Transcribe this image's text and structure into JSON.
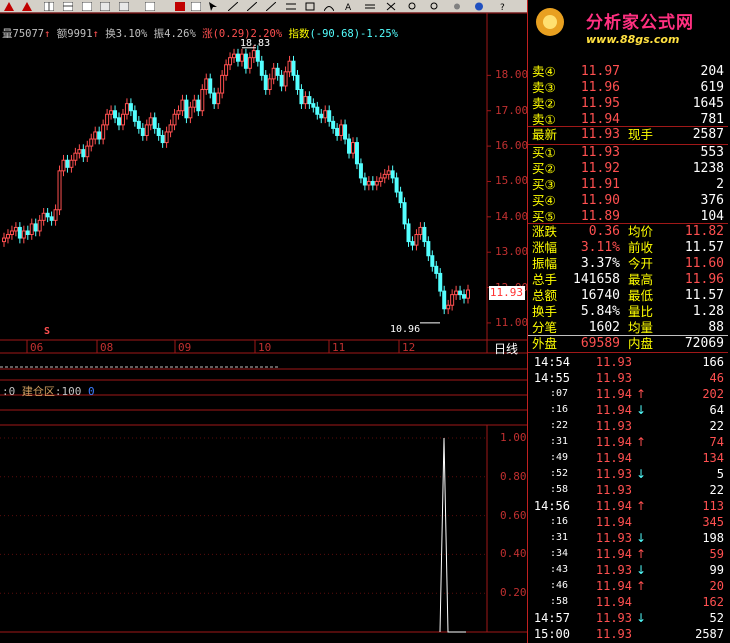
{
  "stock_info": {
    "volume_prefix": "量75077",
    "amount": "额9991",
    "turnover": "换3.10%",
    "amplitude": "振4.26%",
    "change_label": "涨",
    "change": "(0.29)",
    "change_pct": "2.20%",
    "index_label": "指数",
    "index_change": "(-90.68)",
    "index_pct": "-1.25%"
  },
  "chart_data": {
    "type": "candlestick",
    "period_label": "日线",
    "ylim": [
      10.8,
      19.0
    ],
    "y_ticks": [
      "18.00",
      "17.00",
      "16.00",
      "15.00",
      "14.00",
      "13.00",
      "12.00",
      "11.00"
    ],
    "x_ticks": [
      "06",
      "08",
      "09",
      "10",
      "11",
      "12"
    ],
    "high_marker": "18.83",
    "low_marker": "10.96",
    "current_price_tag": "11.93",
    "signal_marker": "S",
    "closes": [
      13.4,
      13.5,
      13.6,
      13.7,
      13.4,
      13.6,
      13.5,
      13.8,
      13.6,
      13.9,
      14.1,
      14.0,
      13.9,
      14.2,
      15.3,
      15.6,
      15.4,
      15.6,
      15.8,
      15.9,
      15.7,
      16.0,
      16.2,
      16.4,
      16.2,
      16.6,
      16.9,
      17.0,
      16.8,
      16.6,
      16.9,
      17.2,
      17.0,
      16.7,
      16.5,
      16.3,
      16.6,
      16.8,
      16.5,
      16.3,
      16.1,
      16.4,
      16.6,
      16.9,
      17.0,
      17.3,
      16.8,
      17.1,
      17.3,
      17.0,
      17.6,
      17.9,
      17.5,
      17.2,
      17.5,
      18.0,
      18.3,
      18.5,
      18.6,
      18.4,
      18.6,
      18.2,
      18.5,
      18.7,
      18.4,
      18.0,
      17.6,
      17.9,
      18.2,
      18.0,
      17.7,
      18.1,
      18.4,
      18.0,
      17.6,
      17.2,
      17.4,
      17.2,
      17.1,
      16.9,
      16.8,
      17.0,
      16.7,
      16.5,
      16.3,
      16.6,
      16.2,
      15.8,
      16.1,
      15.5,
      15.1,
      14.9,
      15.0,
      14.9,
      15.0,
      15.1,
      15.2,
      15.3,
      15.1,
      14.7,
      14.4,
      13.8,
      13.3,
      13.2,
      13.5,
      13.7,
      13.3,
      12.9,
      12.6,
      12.4,
      11.9,
      11.4,
      11.5,
      11.8,
      11.9,
      11.8,
      11.7,
      11.93
    ]
  },
  "indicator_bar": {
    "prefix": ":0",
    "name": "建仓区",
    "sep": ":100",
    "value": "0"
  },
  "lower_chart": {
    "type": "line",
    "ylim": [
      0,
      1
    ],
    "y_ticks": [
      "1.00",
      "0.80",
      "0.60",
      "0.40",
      "0.20"
    ]
  },
  "logo": {
    "title": "分析家公式网",
    "url": "www.88gs.com"
  },
  "order_book": {
    "asks": [
      {
        "label": "卖④",
        "price": "11.97",
        "vol": "204"
      },
      {
        "label": "卖③",
        "price": "11.96",
        "vol": "619"
      },
      {
        "label": "卖②",
        "price": "11.95",
        "vol": "1645"
      },
      {
        "label": "卖①",
        "price": "11.94",
        "vol": "781"
      }
    ],
    "last": {
      "label": "最新",
      "price": "11.93",
      "hand_label": "现手",
      "hand": "2587"
    },
    "bids": [
      {
        "label": "买①",
        "price": "11.93",
        "vol": "553"
      },
      {
        "label": "买②",
        "price": "11.92",
        "vol": "1238"
      },
      {
        "label": "买③",
        "price": "11.91",
        "vol": "2"
      },
      {
        "label": "买④",
        "price": "11.90",
        "vol": "376"
      },
      {
        "label": "买⑤",
        "price": "11.89",
        "vol": "104"
      }
    ]
  },
  "stats": [
    {
      "l1": "涨跌",
      "v1": "0.36",
      "l2": "均价",
      "v2": "11.82",
      "c1": "red",
      "c2": "red"
    },
    {
      "l1": "涨幅",
      "v1": "3.11%",
      "l2": "前收",
      "v2": "11.57",
      "c1": "red",
      "c2": "white"
    },
    {
      "l1": "振幅",
      "v1": "3.37%",
      "l2": "今开",
      "v2": "11.60",
      "c1": "white",
      "c2": "red"
    },
    {
      "l1": "总手",
      "v1": "141658",
      "l2": "最高",
      "v2": "11.96",
      "c1": "white",
      "c2": "red"
    },
    {
      "l1": "总额",
      "v1": "16740",
      "l2": "最低",
      "v2": "11.57",
      "c1": "white",
      "c2": "white"
    },
    {
      "l1": "换手",
      "v1": "5.84%",
      "l2": "量比",
      "v2": "1.28",
      "c1": "white",
      "c2": "white"
    },
    {
      "l1": "分笔",
      "v1": "1602",
      "l2": "均量",
      "v2": "88",
      "c1": "white",
      "c2": "white"
    }
  ],
  "outer_inner": {
    "outer_label": "外盘",
    "outer": "69589",
    "inner_label": "内盘",
    "inner": "72069"
  },
  "ticks": [
    {
      "time": "14:54",
      "price": "11.93",
      "arrow": "",
      "vol": "166",
      "vc": "white"
    },
    {
      "time": "14:55",
      "price": "11.93",
      "arrow": "",
      "vol": "46",
      "vc": "red"
    },
    {
      "time": ":07",
      "price": "11.94",
      "arrow": "up",
      "vol": "202",
      "vc": "red"
    },
    {
      "time": ":16",
      "price": "11.94",
      "arrow": "down",
      "vol": "64",
      "vc": "white"
    },
    {
      "time": ":22",
      "price": "11.93",
      "arrow": "",
      "vol": "22",
      "vc": "white"
    },
    {
      "time": ":31",
      "price": "11.94",
      "arrow": "up",
      "vol": "74",
      "vc": "red"
    },
    {
      "time": ":49",
      "price": "11.94",
      "arrow": "",
      "vol": "134",
      "vc": "red"
    },
    {
      "time": ":52",
      "price": "11.93",
      "arrow": "down",
      "vol": "5",
      "vc": "white"
    },
    {
      "time": ":58",
      "price": "11.93",
      "arrow": "",
      "vol": "22",
      "vc": "white"
    },
    {
      "time": "14:56",
      "price": "11.94",
      "arrow": "up",
      "vol": "113",
      "vc": "red"
    },
    {
      "time": ":16",
      "price": "11.94",
      "arrow": "",
      "vol": "345",
      "vc": "red"
    },
    {
      "time": ":31",
      "price": "11.93",
      "arrow": "down",
      "vol": "198",
      "vc": "white"
    },
    {
      "time": ":34",
      "price": "11.94",
      "arrow": "up",
      "vol": "59",
      "vc": "red"
    },
    {
      "time": ":43",
      "price": "11.93",
      "arrow": "down",
      "vol": "99",
      "vc": "white"
    },
    {
      "time": ":46",
      "price": "11.94",
      "arrow": "up",
      "vol": "20",
      "vc": "red"
    },
    {
      "time": ":58",
      "price": "11.94",
      "arrow": "",
      "vol": "162",
      "vc": "red"
    },
    {
      "time": "14:57",
      "price": "11.93",
      "arrow": "down",
      "vol": "52",
      "vc": "white"
    },
    {
      "time": "15:00",
      "price": "11.93",
      "arrow": "",
      "vol": "2587",
      "vc": "white"
    }
  ],
  "colors": {
    "up": "#ff5050",
    "down": "#54ffff",
    "label": "#ffff00",
    "grid": "#a01818"
  }
}
